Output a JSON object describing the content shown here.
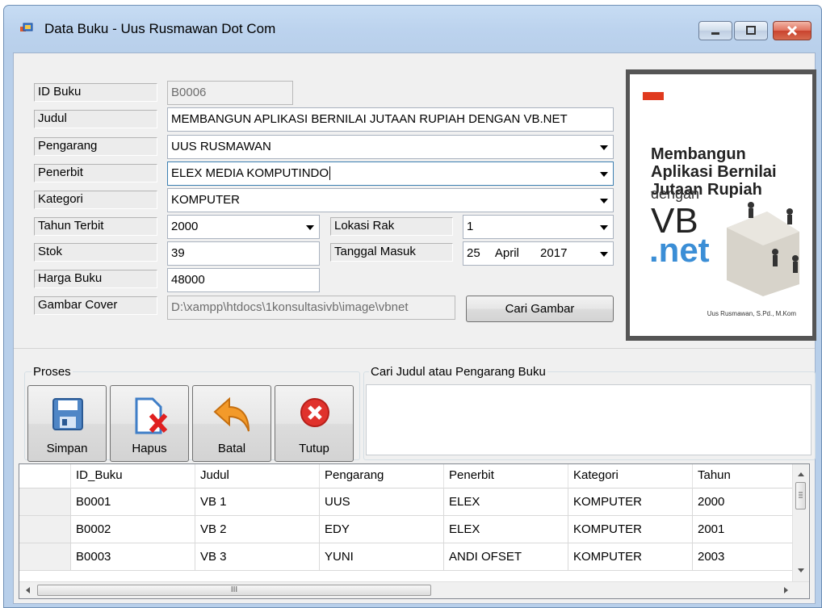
{
  "window": {
    "title": "Data Buku - Uus Rusmawan Dot Com"
  },
  "form": {
    "labels": {
      "id": "ID Buku",
      "judul": "Judul",
      "pengarang": "Pengarang",
      "penerbit": "Penerbit",
      "kategori": "Kategori",
      "tahun": "Tahun Terbit",
      "stok": "Stok",
      "harga": "Harga Buku",
      "gambar": "Gambar Cover",
      "lokasi": "Lokasi Rak",
      "tanggal": "Tanggal Masuk"
    },
    "values": {
      "id": "B0006",
      "judul": "MEMBANGUN APLIKASI BERNILAI JUTAAN RUPIAH DENGAN VB.NET",
      "pengarang": "UUS RUSMAWAN",
      "penerbit": "ELEX MEDIA KOMPUTINDO",
      "kategori": "KOMPUTER",
      "tahun": "2000",
      "stok": "39",
      "harga": "48000",
      "gambar": "D:\\xampp\\htdocs\\1konsultasivb\\image\\vbnet",
      "lokasi": "1",
      "tanggal_day": "25",
      "tanggal_month": "April",
      "tanggal_year": "2017"
    },
    "cari_gambar_label": "Cari Gambar"
  },
  "cover": {
    "title_lines": [
      "Membangun",
      "Aplikasi Bernilai",
      "Jutaan Rupiah"
    ],
    "dengan": "dengan",
    "vb": "VB",
    "net": ".net",
    "author": "Uus Rusmawan, S.Pd., M.Kom"
  },
  "proses": {
    "title": "Proses",
    "buttons": {
      "simpan": "Simpan",
      "hapus": "Hapus",
      "batal": "Batal",
      "tutup": "Tutup"
    }
  },
  "search": {
    "title": "Cari Judul atau Pengarang Buku",
    "value": ""
  },
  "grid": {
    "columns": [
      "ID_Buku",
      "Judul",
      "Pengarang",
      "Penerbit",
      "Kategori",
      "Tahun"
    ],
    "rows": [
      [
        "B0001",
        "VB 1",
        "UUS",
        "ELEX",
        "KOMPUTER",
        "2000"
      ],
      [
        "B0002",
        "VB 2",
        "EDY",
        "ELEX",
        "KOMPUTER",
        "2001"
      ],
      [
        "B0003",
        "VB 3",
        "YUNI",
        "ANDI OFSET",
        "KOMPUTER",
        "2003"
      ]
    ],
    "hscroll_grip": "III"
  }
}
